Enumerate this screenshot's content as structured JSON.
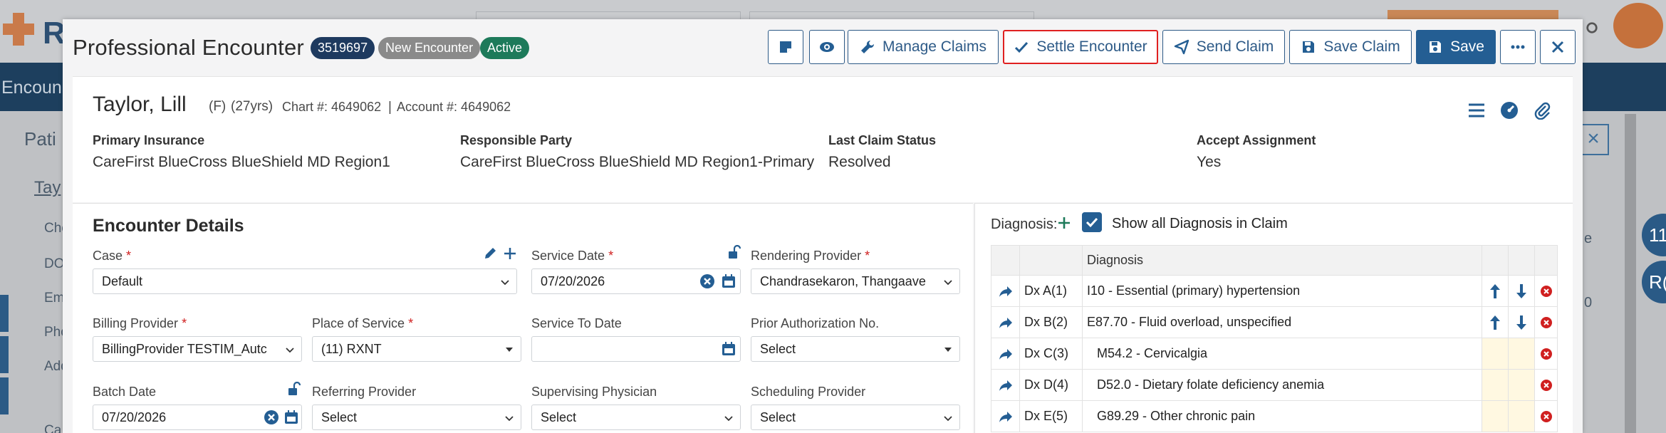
{
  "background": {
    "nav_label": "Encoun",
    "left_labels": [
      "Pati",
      "Tay",
      "Che",
      "DO",
      "Em",
      "Pho",
      "Add",
      "Ca"
    ],
    "right_badges": [
      "11",
      "R("
    ],
    "right_col_labels": [
      "e",
      "0"
    ]
  },
  "modal": {
    "title": "Professional Encounter",
    "badges": {
      "id": "3519697",
      "status_new": "New Encounter",
      "status_active": "Active"
    },
    "toolbar": {
      "manage_claims": "Manage Claims",
      "settle_encounter": "Settle Encounter",
      "send_claim": "Send Claim",
      "save_claim": "Save Claim",
      "save": "Save"
    }
  },
  "patient": {
    "name": "Taylor, Lill",
    "gender": "(F)",
    "age": "(27yrs)",
    "chart": "Chart #: 4649062",
    "sep": "|",
    "account": "Account #: 4649062",
    "primary_insurance_label": "Primary Insurance",
    "primary_insurance": "CareFirst BlueCross BlueShield MD Region1",
    "responsible_party_label": "Responsible Party",
    "responsible_party": "CareFirst BlueCross BlueShield MD Region1-Primary",
    "last_claim_status_label": "Last Claim Status",
    "last_claim_status": "Resolved",
    "accept_assignment_label": "Accept Assignment",
    "accept_assignment": "Yes"
  },
  "encounter": {
    "title": "Encounter Details",
    "case_label": "Case",
    "case_value": "Default",
    "service_date_label": "Service Date",
    "service_date_value": "07/20/2026",
    "rendering_provider_label": "Rendering Provider",
    "rendering_provider_value": "Chandrasekaron, Thangaave",
    "billing_provider_label": "Billing Provider",
    "billing_provider_value": "BillingProvider TESTIM_Autc",
    "place_of_service_label": "Place of Service",
    "place_of_service_value": "(11) RXNT",
    "service_to_date_label": "Service To Date",
    "service_to_date_value": "",
    "prior_auth_label": "Prior Authorization No.",
    "prior_auth_value": "Select",
    "batch_date_label": "Batch Date",
    "batch_date_value": "07/20/2026",
    "referring_provider_label": "Referring Provider",
    "referring_provider_value": "Select",
    "supervising_physician_label": "Supervising Physician",
    "supervising_physician_value": "Select",
    "scheduling_provider_label": "Scheduling Provider",
    "scheduling_provider_value": "Select",
    "required_mark": "*"
  },
  "diagnosis": {
    "label": "Diagnosis:",
    "show_all_label": "Show all Diagnosis in Claim",
    "column_header": "Diagnosis",
    "rows": [
      {
        "code": "Dx A(1)",
        "desc": "I10 - Essential (primary) hypertension"
      },
      {
        "code": "Dx B(2)",
        "desc": "E87.70 - Fluid overload, unspecified"
      },
      {
        "code": "Dx C(3)",
        "desc": "M54.2 - Cervicalgia"
      },
      {
        "code": "Dx D(4)",
        "desc": "D52.0 - Dietary folate deficiency anemia"
      },
      {
        "code": "Dx E(5)",
        "desc": "G89.29 - Other chronic pain"
      }
    ]
  },
  "colors": {
    "primary": "#245e93",
    "danger": "#d02020",
    "active": "#1d7a5a"
  }
}
